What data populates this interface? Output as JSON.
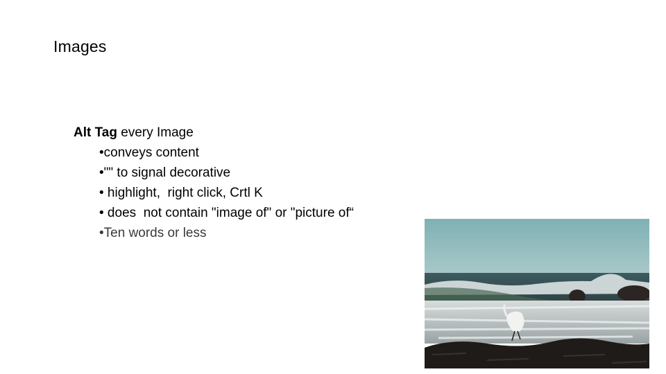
{
  "slide": {
    "title": "Images",
    "heading": {
      "bold": "Alt Tag",
      "rest": " every Image"
    },
    "bullets": [
      "•conveys content",
      "•\"\" to signal decorative",
      "• highlight,  right click, Crtl K",
      "• does  not contain \"image of\" or \"picture of“",
      "•Ten words or less"
    ],
    "image": {
      "description": "photo-of-egret-on-rocky-shore-with-crashing-waves"
    }
  }
}
